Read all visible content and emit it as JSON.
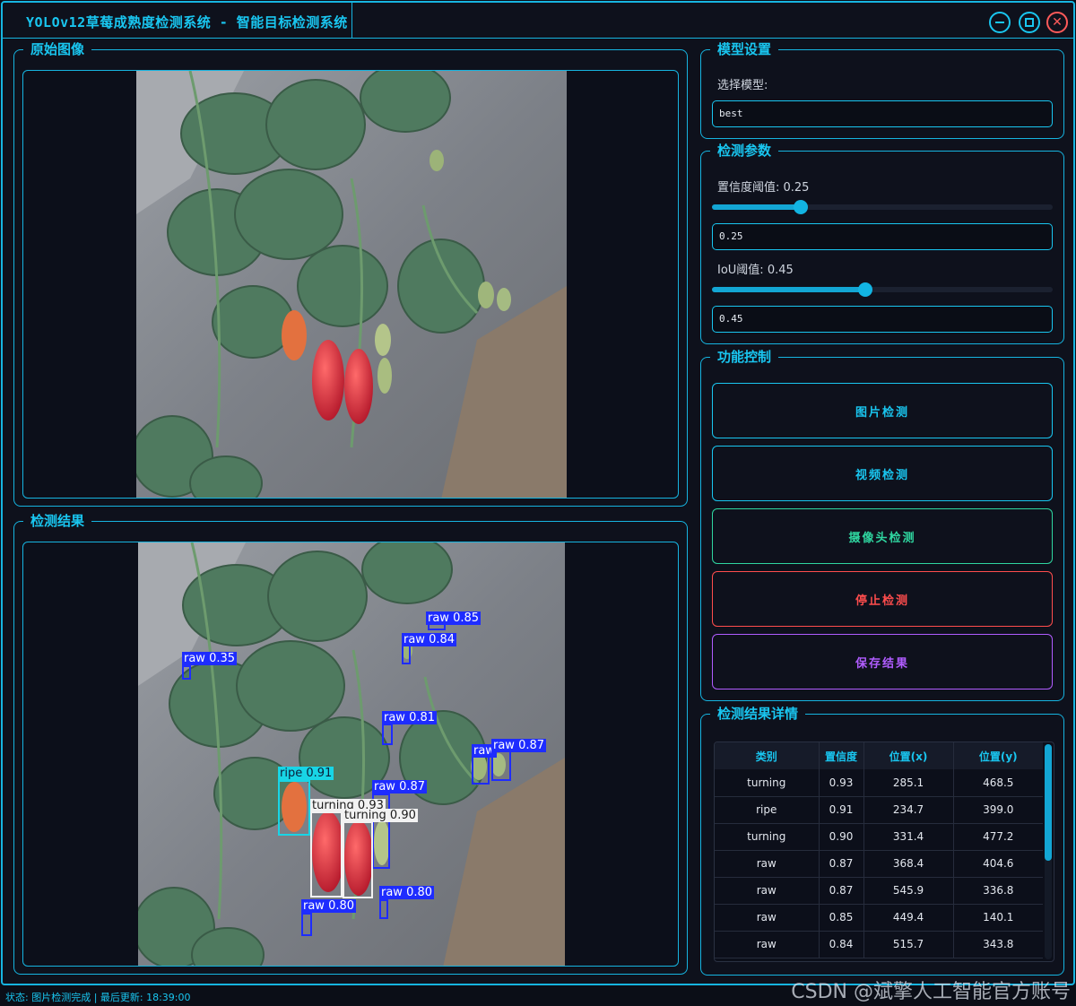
{
  "window": {
    "title": "YOLOv12草莓成熟度检测系统 - 智能目标检测系统"
  },
  "panels": {
    "original_image": "原始图像",
    "detection_result": "检测结果",
    "model_settings": "模型设置",
    "detect_params": "检测参数",
    "function_control": "功能控制",
    "result_details": "检测结果详情"
  },
  "model": {
    "select_label": "选择模型:",
    "value": "best"
  },
  "params": {
    "conf_label": "置信度阈值: 0.25",
    "conf_value": "0.25",
    "conf_level": 0.26,
    "iou_label": "IoU阈值: 0.45",
    "iou_value": "0.45",
    "iou_level": 0.45
  },
  "buttons": {
    "image_detect": "图片检测",
    "video_detect": "视频检测",
    "camera_detect": "摄像头检测",
    "stop_detect": "停止检测",
    "save_result": "保存结果"
  },
  "colors": {
    "accent": "#19c6f0",
    "raw_box": "#1e2cff",
    "ripe_box": "#18d5e6",
    "turning_box": "#f2f2f2",
    "stop": "#ff4d4d",
    "camera": "#2fd6a0",
    "save": "#b05cff"
  },
  "detections": [
    {
      "label": "raw 0.85",
      "class": "raw"
    },
    {
      "label": "raw 0.84",
      "class": "raw"
    },
    {
      "label": "raw 0.35",
      "class": "raw"
    },
    {
      "label": "raw 0.81",
      "class": "raw"
    },
    {
      "label": "raw 0.87",
      "class": "raw"
    },
    {
      "label": "raw 0.87",
      "class": "raw"
    },
    {
      "label": "ripe 0.91",
      "class": "ripe"
    },
    {
      "label": "turning 0.93",
      "class": "turning"
    },
    {
      "label": "turning 0.90",
      "class": "turning"
    },
    {
      "label": "raw 0.80",
      "class": "raw"
    },
    {
      "label": "raw 0.80",
      "class": "raw"
    },
    {
      "label": "raw",
      "class": "raw"
    }
  ],
  "table": {
    "headers": [
      "类别",
      "置信度",
      "位置(x)",
      "位置(y)"
    ],
    "rows": [
      [
        "turning",
        "0.93",
        "285.1",
        "468.5"
      ],
      [
        "ripe",
        "0.91",
        "234.7",
        "399.0"
      ],
      [
        "turning",
        "0.90",
        "331.4",
        "477.2"
      ],
      [
        "raw",
        "0.87",
        "368.4",
        "404.6"
      ],
      [
        "raw",
        "0.87",
        "545.9",
        "336.8"
      ],
      [
        "raw",
        "0.85",
        "449.4",
        "140.1"
      ],
      [
        "raw",
        "0.84",
        "515.7",
        "343.8"
      ]
    ]
  },
  "status": "状态: 图片检测完成 | 最后更新: 18:39:00",
  "watermark": "CSDN @斌擎人工智能官方账号"
}
